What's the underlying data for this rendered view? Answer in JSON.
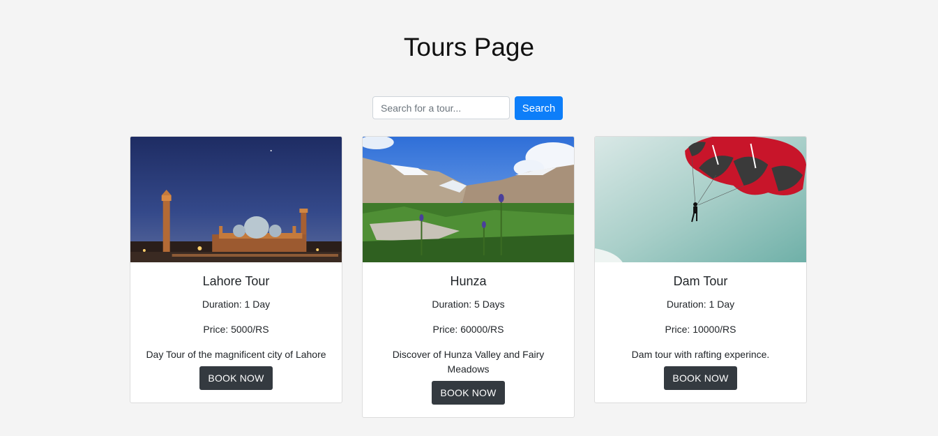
{
  "page": {
    "title": "Tours Page"
  },
  "search": {
    "placeholder": "Search for a tour...",
    "value": "",
    "button_label": "Search"
  },
  "colors": {
    "background": "#f4f4f4",
    "primary_button": "#0d7ef9",
    "dark_button": "#343a40"
  },
  "tours": [
    {
      "title": "Lahore Tour",
      "duration": "Duration: 1 Day",
      "price": "Price: 5000/RS",
      "description": "Day Tour of the magnificent city of Lahore",
      "button_label": "BOOK NOW",
      "image": "mosque-at-night-photo"
    },
    {
      "title": "Hunza",
      "duration": "Duration: 5 Days",
      "price": "Price: 60000/RS",
      "description": "Discover of Hunza Valley and Fairy Meadows",
      "button_label": "BOOK NOW",
      "image": "mountain-valley-photo"
    },
    {
      "title": "Dam Tour",
      "duration": "Duration: 1 Day",
      "price": "Price: 10000/RS",
      "description": "Dam tour with rafting experince.",
      "button_label": "BOOK NOW",
      "image": "parasailing-photo"
    }
  ]
}
